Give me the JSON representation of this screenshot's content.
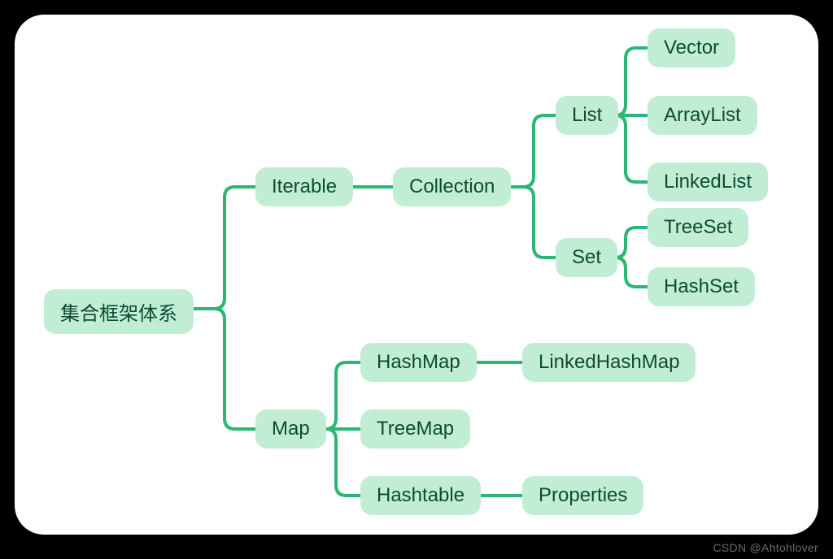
{
  "chart_data": {
    "type": "tree",
    "title": "集合框架体系",
    "root": "集合框架体系",
    "children": [
      {
        "name": "Iterable",
        "children": [
          {
            "name": "Collection",
            "children": [
              {
                "name": "List",
                "children": [
                  {
                    "name": "Vector"
                  },
                  {
                    "name": "ArrayList"
                  },
                  {
                    "name": "LinkedList"
                  }
                ]
              },
              {
                "name": "Set",
                "children": [
                  {
                    "name": "TreeSet"
                  },
                  {
                    "name": "HashSet"
                  }
                ]
              }
            ]
          }
        ]
      },
      {
        "name": "Map",
        "children": [
          {
            "name": "HashMap",
            "children": [
              {
                "name": "LinkedHashMap"
              }
            ]
          },
          {
            "name": "TreeMap"
          },
          {
            "name": "Hashtable",
            "children": [
              {
                "name": "Properties"
              }
            ]
          }
        ]
      }
    ]
  },
  "labels": {
    "root": "集合框架体系",
    "iterable": "Iterable",
    "collection": "Collection",
    "list": "List",
    "set": "Set",
    "vector": "Vector",
    "arraylist": "ArrayList",
    "linkedlist": "LinkedList",
    "treeset": "TreeSet",
    "hashset": "HashSet",
    "map": "Map",
    "hashmap": "HashMap",
    "treemap": "TreeMap",
    "hashtable": "Hashtable",
    "linkedhashmap": "LinkedHashMap",
    "properties": "Properties"
  },
  "watermark": "CSDN @Ahtohlover",
  "colors": {
    "node_fill": "#c1edd5",
    "node_text": "#0d4b34",
    "connector": "#2bb673"
  }
}
